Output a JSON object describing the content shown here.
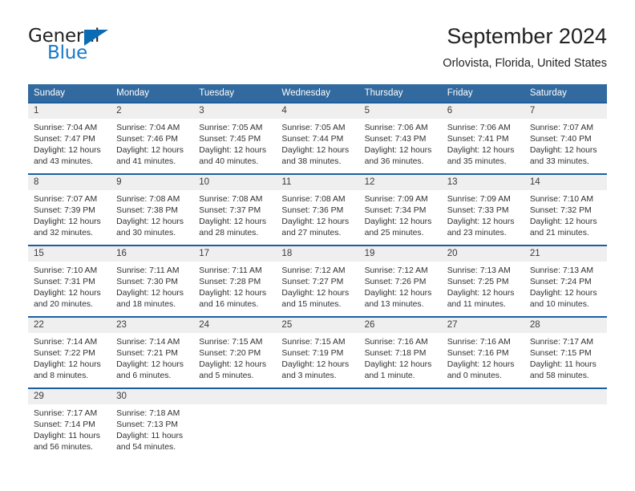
{
  "brand": {
    "name_part1": "General",
    "name_part2": "Blue",
    "accent_color": "#1878c8",
    "triangle_color": "#0a6cb4"
  },
  "header": {
    "title": "September 2024",
    "subtitle": "Orlovista, Florida, United States"
  },
  "theme": {
    "header_bar_color": "#32699e",
    "row_rule_color": "#1a5fa0",
    "daynum_bg": "#efefef"
  },
  "weekdays": [
    "Sunday",
    "Monday",
    "Tuesday",
    "Wednesday",
    "Thursday",
    "Friday",
    "Saturday"
  ],
  "labels": {
    "sunrise_prefix": "Sunrise:",
    "sunset_prefix": "Sunset:",
    "daylight_prefix": "Daylight:"
  },
  "weeks": [
    [
      {
        "day": "1",
        "sunrise": "Sunrise: 7:04 AM",
        "sunset": "Sunset: 7:47 PM",
        "daylight_line1": "Daylight: 12 hours",
        "daylight_line2": "and 43 minutes."
      },
      {
        "day": "2",
        "sunrise": "Sunrise: 7:04 AM",
        "sunset": "Sunset: 7:46 PM",
        "daylight_line1": "Daylight: 12 hours",
        "daylight_line2": "and 41 minutes."
      },
      {
        "day": "3",
        "sunrise": "Sunrise: 7:05 AM",
        "sunset": "Sunset: 7:45 PM",
        "daylight_line1": "Daylight: 12 hours",
        "daylight_line2": "and 40 minutes."
      },
      {
        "day": "4",
        "sunrise": "Sunrise: 7:05 AM",
        "sunset": "Sunset: 7:44 PM",
        "daylight_line1": "Daylight: 12 hours",
        "daylight_line2": "and 38 minutes."
      },
      {
        "day": "5",
        "sunrise": "Sunrise: 7:06 AM",
        "sunset": "Sunset: 7:43 PM",
        "daylight_line1": "Daylight: 12 hours",
        "daylight_line2": "and 36 minutes."
      },
      {
        "day": "6",
        "sunrise": "Sunrise: 7:06 AM",
        "sunset": "Sunset: 7:41 PM",
        "daylight_line1": "Daylight: 12 hours",
        "daylight_line2": "and 35 minutes."
      },
      {
        "day": "7",
        "sunrise": "Sunrise: 7:07 AM",
        "sunset": "Sunset: 7:40 PM",
        "daylight_line1": "Daylight: 12 hours",
        "daylight_line2": "and 33 minutes."
      }
    ],
    [
      {
        "day": "8",
        "sunrise": "Sunrise: 7:07 AM",
        "sunset": "Sunset: 7:39 PM",
        "daylight_line1": "Daylight: 12 hours",
        "daylight_line2": "and 32 minutes."
      },
      {
        "day": "9",
        "sunrise": "Sunrise: 7:08 AM",
        "sunset": "Sunset: 7:38 PM",
        "daylight_line1": "Daylight: 12 hours",
        "daylight_line2": "and 30 minutes."
      },
      {
        "day": "10",
        "sunrise": "Sunrise: 7:08 AM",
        "sunset": "Sunset: 7:37 PM",
        "daylight_line1": "Daylight: 12 hours",
        "daylight_line2": "and 28 minutes."
      },
      {
        "day": "11",
        "sunrise": "Sunrise: 7:08 AM",
        "sunset": "Sunset: 7:36 PM",
        "daylight_line1": "Daylight: 12 hours",
        "daylight_line2": "and 27 minutes."
      },
      {
        "day": "12",
        "sunrise": "Sunrise: 7:09 AM",
        "sunset": "Sunset: 7:34 PM",
        "daylight_line1": "Daylight: 12 hours",
        "daylight_line2": "and 25 minutes."
      },
      {
        "day": "13",
        "sunrise": "Sunrise: 7:09 AM",
        "sunset": "Sunset: 7:33 PM",
        "daylight_line1": "Daylight: 12 hours",
        "daylight_line2": "and 23 minutes."
      },
      {
        "day": "14",
        "sunrise": "Sunrise: 7:10 AM",
        "sunset": "Sunset: 7:32 PM",
        "daylight_line1": "Daylight: 12 hours",
        "daylight_line2": "and 21 minutes."
      }
    ],
    [
      {
        "day": "15",
        "sunrise": "Sunrise: 7:10 AM",
        "sunset": "Sunset: 7:31 PM",
        "daylight_line1": "Daylight: 12 hours",
        "daylight_line2": "and 20 minutes."
      },
      {
        "day": "16",
        "sunrise": "Sunrise: 7:11 AM",
        "sunset": "Sunset: 7:30 PM",
        "daylight_line1": "Daylight: 12 hours",
        "daylight_line2": "and 18 minutes."
      },
      {
        "day": "17",
        "sunrise": "Sunrise: 7:11 AM",
        "sunset": "Sunset: 7:28 PM",
        "daylight_line1": "Daylight: 12 hours",
        "daylight_line2": "and 16 minutes."
      },
      {
        "day": "18",
        "sunrise": "Sunrise: 7:12 AM",
        "sunset": "Sunset: 7:27 PM",
        "daylight_line1": "Daylight: 12 hours",
        "daylight_line2": "and 15 minutes."
      },
      {
        "day": "19",
        "sunrise": "Sunrise: 7:12 AM",
        "sunset": "Sunset: 7:26 PM",
        "daylight_line1": "Daylight: 12 hours",
        "daylight_line2": "and 13 minutes."
      },
      {
        "day": "20",
        "sunrise": "Sunrise: 7:13 AM",
        "sunset": "Sunset: 7:25 PM",
        "daylight_line1": "Daylight: 12 hours",
        "daylight_line2": "and 11 minutes."
      },
      {
        "day": "21",
        "sunrise": "Sunrise: 7:13 AM",
        "sunset": "Sunset: 7:24 PM",
        "daylight_line1": "Daylight: 12 hours",
        "daylight_line2": "and 10 minutes."
      }
    ],
    [
      {
        "day": "22",
        "sunrise": "Sunrise: 7:14 AM",
        "sunset": "Sunset: 7:22 PM",
        "daylight_line1": "Daylight: 12 hours",
        "daylight_line2": "and 8 minutes."
      },
      {
        "day": "23",
        "sunrise": "Sunrise: 7:14 AM",
        "sunset": "Sunset: 7:21 PM",
        "daylight_line1": "Daylight: 12 hours",
        "daylight_line2": "and 6 minutes."
      },
      {
        "day": "24",
        "sunrise": "Sunrise: 7:15 AM",
        "sunset": "Sunset: 7:20 PM",
        "daylight_line1": "Daylight: 12 hours",
        "daylight_line2": "and 5 minutes."
      },
      {
        "day": "25",
        "sunrise": "Sunrise: 7:15 AM",
        "sunset": "Sunset: 7:19 PM",
        "daylight_line1": "Daylight: 12 hours",
        "daylight_line2": "and 3 minutes."
      },
      {
        "day": "26",
        "sunrise": "Sunrise: 7:16 AM",
        "sunset": "Sunset: 7:18 PM",
        "daylight_line1": "Daylight: 12 hours",
        "daylight_line2": "and 1 minute."
      },
      {
        "day": "27",
        "sunrise": "Sunrise: 7:16 AM",
        "sunset": "Sunset: 7:16 PM",
        "daylight_line1": "Daylight: 12 hours",
        "daylight_line2": "and 0 minutes."
      },
      {
        "day": "28",
        "sunrise": "Sunrise: 7:17 AM",
        "sunset": "Sunset: 7:15 PM",
        "daylight_line1": "Daylight: 11 hours",
        "daylight_line2": "and 58 minutes."
      }
    ],
    [
      {
        "day": "29",
        "sunrise": "Sunrise: 7:17 AM",
        "sunset": "Sunset: 7:14 PM",
        "daylight_line1": "Daylight: 11 hours",
        "daylight_line2": "and 56 minutes."
      },
      {
        "day": "30",
        "sunrise": "Sunrise: 7:18 AM",
        "sunset": "Sunset: 7:13 PM",
        "daylight_line1": "Daylight: 11 hours",
        "daylight_line2": "and 54 minutes."
      },
      {
        "day": "",
        "sunrise": "",
        "sunset": "",
        "daylight_line1": "",
        "daylight_line2": ""
      },
      {
        "day": "",
        "sunrise": "",
        "sunset": "",
        "daylight_line1": "",
        "daylight_line2": ""
      },
      {
        "day": "",
        "sunrise": "",
        "sunset": "",
        "daylight_line1": "",
        "daylight_line2": ""
      },
      {
        "day": "",
        "sunrise": "",
        "sunset": "",
        "daylight_line1": "",
        "daylight_line2": ""
      },
      {
        "day": "",
        "sunrise": "",
        "sunset": "",
        "daylight_line1": "",
        "daylight_line2": ""
      }
    ]
  ]
}
